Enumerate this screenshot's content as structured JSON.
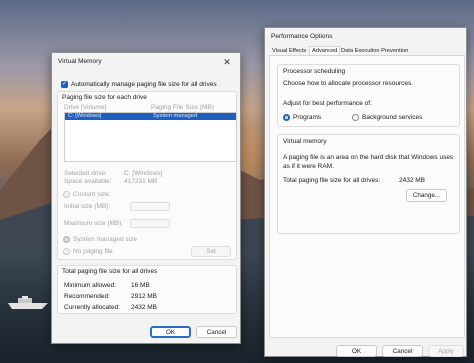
{
  "virtual_memory": {
    "title": "Virtual Memory",
    "close_icon": "close-icon",
    "auto_manage_label": "Automatically manage paging file size for all drives",
    "auto_manage_checked": true,
    "section_label": "Paging file size for each drive",
    "columns": {
      "drive": "Drive [Volume]",
      "size": "Paging File Size (MB)"
    },
    "drives": [
      {
        "drive": "C:  [Windows]",
        "size": "System managed"
      }
    ],
    "selected_drive_label": "Selected drive:",
    "selected_drive_value": "C:  [Windows]",
    "space_available_label": "Space available:",
    "space_available_value": "417231 MB",
    "custom_size_label": "Custom size:",
    "initial_size_label": "Initial size (MB):",
    "maximum_size_label": "Maximum size (MB):",
    "system_managed_label": "System managed size",
    "no_paging_label": "No paging file",
    "set_button": "Set",
    "totals_title": "Total paging file size for all drives",
    "minimum_label": "Minimum allowed:",
    "minimum_value": "16 MB",
    "recommended_label": "Recommended:",
    "recommended_value": "2912 MB",
    "allocated_label": "Currently allocated:",
    "allocated_value": "2432 MB",
    "ok_button": "OK",
    "cancel_button": "Cancel"
  },
  "performance_options": {
    "title": "Performance Options",
    "tabs": [
      {
        "label": "Visual Effects",
        "active": false
      },
      {
        "label": "Advanced",
        "active": true
      },
      {
        "label": "Data Execution Prevention",
        "active": false
      }
    ],
    "processor": {
      "title": "Processor scheduling",
      "description": "Choose how to allocate processor resources.",
      "adjust_label": "Adjust for best performance of:",
      "programs_label": "Programs",
      "programs_selected": true,
      "background_label": "Background services"
    },
    "virtual_memory": {
      "title": "Virtual memory",
      "description_line1": "A paging file is an area on the hard disk that Windows uses",
      "description_line2": "as if it were RAM.",
      "total_label": "Total paging file size for all drives:",
      "total_value": "2432 MB",
      "change_button": "Change..."
    },
    "ok_button": "OK",
    "cancel_button": "Cancel",
    "apply_button": "Apply"
  },
  "colors": {
    "accent": "#1f5fc0",
    "selection": "#1f5fc0",
    "dialog_bg": "#f3f3f3"
  }
}
